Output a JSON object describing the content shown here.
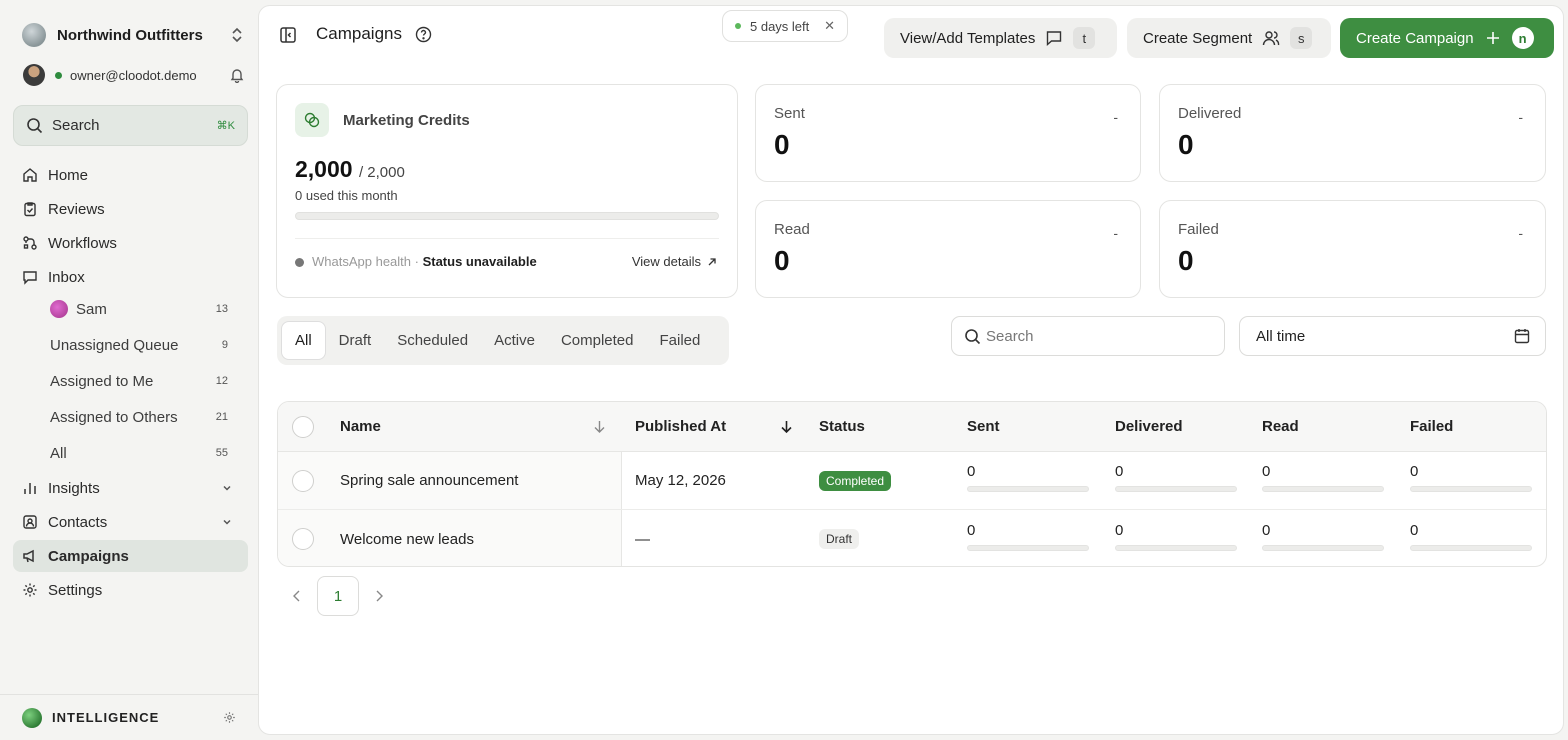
{
  "sidebar": {
    "org_name": "Northwind Outfitters",
    "user_email": "owner@cloodot.demo",
    "search_label": "Search",
    "search_shortcut": "⌘K",
    "nav": {
      "home": "Home",
      "reviews": "Reviews",
      "workflows": "Workflows",
      "inbox": "Inbox",
      "insights": "Insights",
      "contacts": "Contacts",
      "campaigns": "Campaigns",
      "settings": "Settings"
    },
    "inbox_items": [
      {
        "label": "Sam",
        "count": "13"
      },
      {
        "label": "Unassigned Queue",
        "count": "9"
      },
      {
        "label": "Assigned to Me",
        "count": "12"
      },
      {
        "label": "Assigned to Others",
        "count": "21"
      },
      {
        "label": "All",
        "count": "55"
      }
    ],
    "intelligence_label": "INTELLIGENCE"
  },
  "header": {
    "title": "Campaigns",
    "trial_label": "5 days left",
    "trial_close": "✕",
    "templates_button": "View/Add Templates",
    "templates_key": "t",
    "segment_button": "Create Segment",
    "segment_key": "s",
    "campaign_button": "Create Campaign",
    "campaign_key": "n"
  },
  "credits": {
    "title": "Marketing Credits",
    "remaining": "2,000",
    "total": "/ 2,000",
    "used_text": "0 used this month",
    "used_fraction": 0,
    "wa_label": "WhatsApp health · ",
    "wa_status": "Status unavailable",
    "view_details": "View details"
  },
  "stats": {
    "sent": {
      "label": "Sent",
      "value": "0",
      "trend": "-"
    },
    "delivered": {
      "label": "Delivered",
      "value": "0",
      "trend": "-"
    },
    "read": {
      "label": "Read",
      "value": "0",
      "trend": "-"
    },
    "failed": {
      "label": "Failed",
      "value": "0",
      "trend": "-"
    }
  },
  "tabs": [
    "All",
    "Draft",
    "Scheduled",
    "Active",
    "Completed",
    "Failed"
  ],
  "active_tab": "All",
  "filters": {
    "search_placeholder": "Search",
    "date_range": "All time"
  },
  "table": {
    "columns": {
      "name": "Name",
      "published": "Published At",
      "status": "Status",
      "sent": "Sent",
      "delivered": "Delivered",
      "read": "Read",
      "failed": "Failed"
    },
    "rows": [
      {
        "name": "Spring sale announcement",
        "published": "May 12, 2026",
        "status": "Completed",
        "sent": "0",
        "delivered": "0",
        "read": "0",
        "failed": "0"
      },
      {
        "name": "Welcome new leads",
        "published": "—",
        "status": "Draft",
        "sent": "0",
        "delivered": "0",
        "read": "0",
        "failed": "0"
      }
    ]
  },
  "pagination": {
    "current_page": "1"
  },
  "colors": {
    "accent": "#3e8e41",
    "sidebar_bg": "#f4f4f2",
    "active_nav_bg": "#e0e5e0"
  }
}
